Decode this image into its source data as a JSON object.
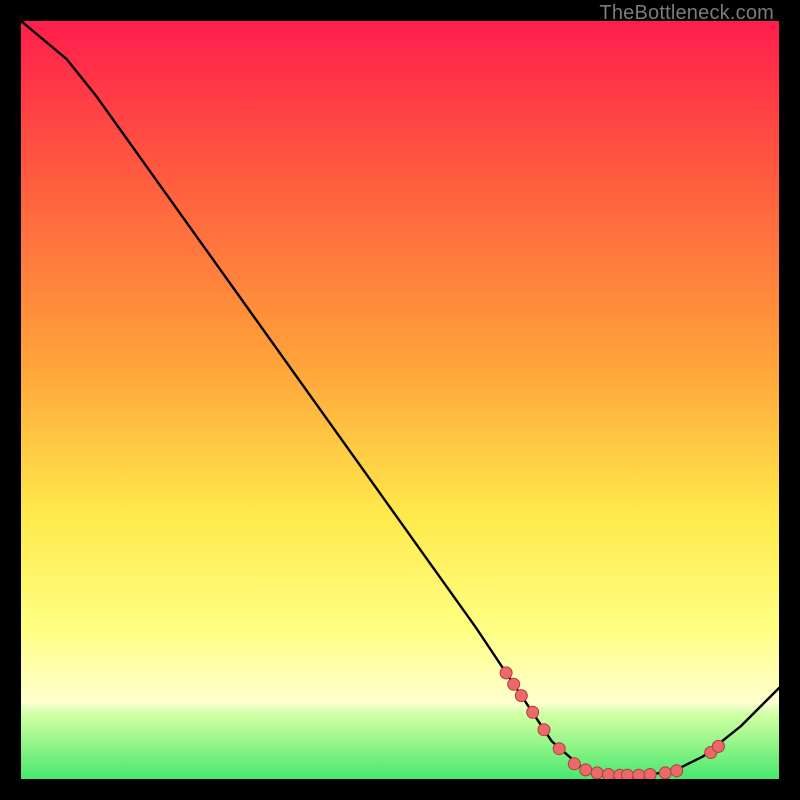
{
  "watermark": "TheBottleneck.com",
  "colors": {
    "curve": "#000000",
    "marker_fill": "#eb6969",
    "marker_stroke": "#b03d3d"
  },
  "chart_data": {
    "type": "line",
    "title": "",
    "xlabel": "",
    "ylabel": "",
    "xlim": [
      0,
      100
    ],
    "ylim": [
      0,
      100
    ],
    "x_is_component_score": true,
    "y_is_bottleneck_percent": true,
    "curve": [
      {
        "x": 0,
        "y": 100
      },
      {
        "x": 6,
        "y": 95
      },
      {
        "x": 10,
        "y": 90
      },
      {
        "x": 20,
        "y": 76
      },
      {
        "x": 30,
        "y": 62
      },
      {
        "x": 40,
        "y": 48
      },
      {
        "x": 50,
        "y": 34
      },
      {
        "x": 60,
        "y": 20
      },
      {
        "x": 66,
        "y": 11
      },
      {
        "x": 70,
        "y": 5
      },
      {
        "x": 74,
        "y": 1.5
      },
      {
        "x": 78,
        "y": 0.5
      },
      {
        "x": 82,
        "y": 0.5
      },
      {
        "x": 86,
        "y": 1
      },
      {
        "x": 90,
        "y": 3
      },
      {
        "x": 95,
        "y": 7
      },
      {
        "x": 100,
        "y": 12
      }
    ],
    "markers": [
      {
        "x": 64,
        "y": 14
      },
      {
        "x": 65,
        "y": 12.5
      },
      {
        "x": 66,
        "y": 11
      },
      {
        "x": 67.5,
        "y": 8.8
      },
      {
        "x": 69,
        "y": 6.5
      },
      {
        "x": 71,
        "y": 4
      },
      {
        "x": 73,
        "y": 2
      },
      {
        "x": 74.5,
        "y": 1.2
      },
      {
        "x": 76,
        "y": 0.8
      },
      {
        "x": 77.5,
        "y": 0.6
      },
      {
        "x": 79,
        "y": 0.5
      },
      {
        "x": 80,
        "y": 0.5
      },
      {
        "x": 81.5,
        "y": 0.5
      },
      {
        "x": 83,
        "y": 0.6
      },
      {
        "x": 85,
        "y": 0.8
      },
      {
        "x": 86.5,
        "y": 1.1
      },
      {
        "x": 91,
        "y": 3.5
      },
      {
        "x": 92,
        "y": 4.3
      }
    ]
  }
}
